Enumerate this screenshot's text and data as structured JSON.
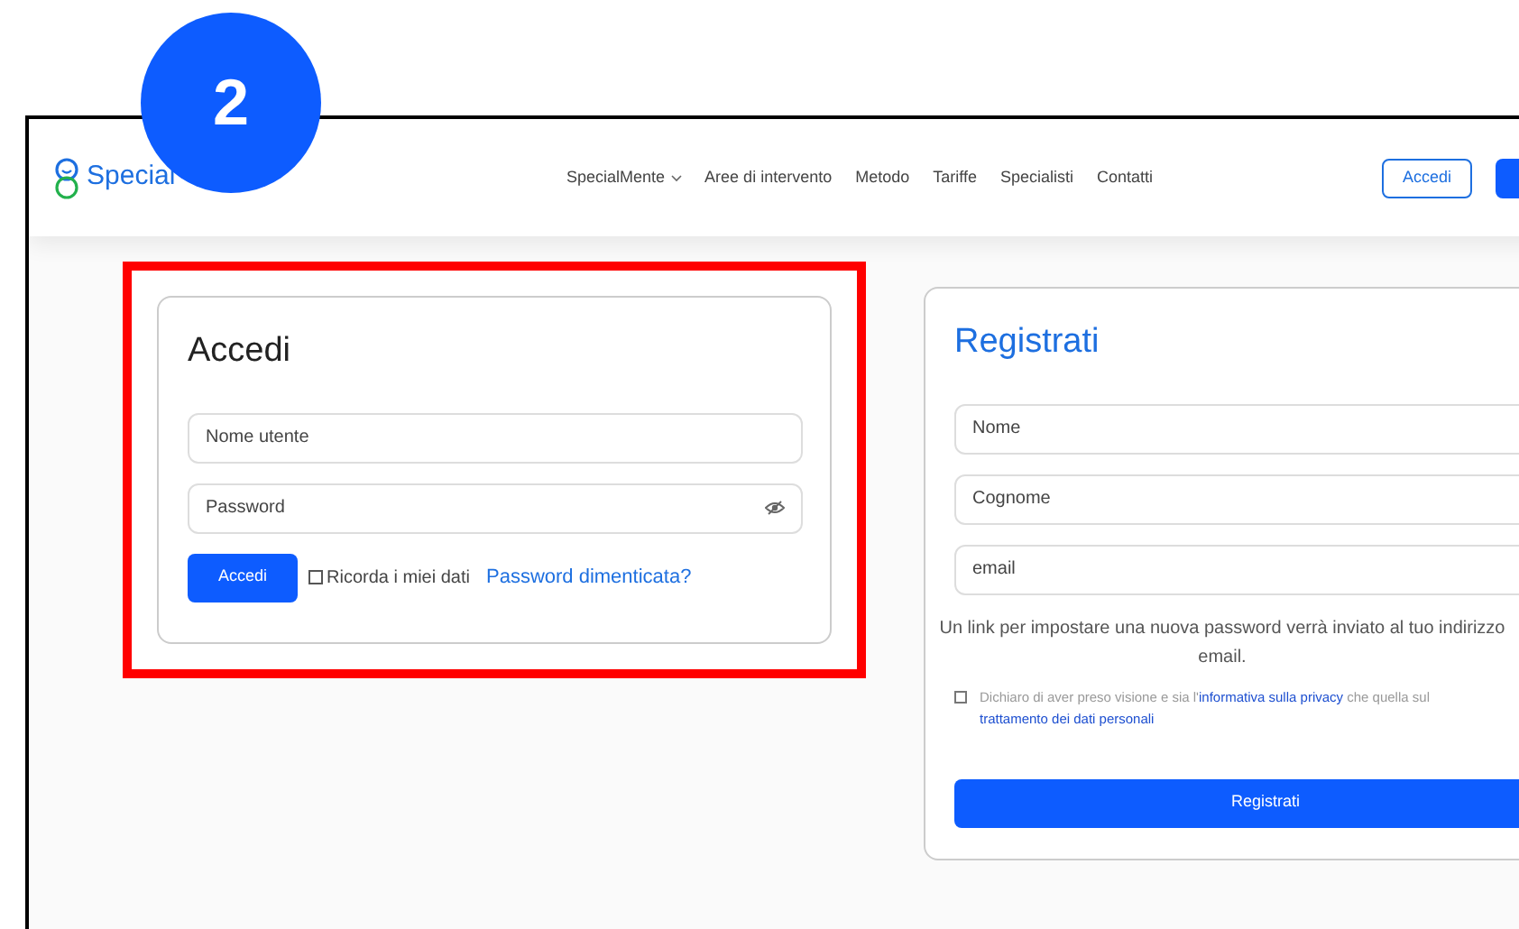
{
  "step_badge": "2",
  "header": {
    "logo": "Special",
    "nav": [
      {
        "label": "SpecialMente",
        "dropdown": true
      },
      {
        "label": "Aree di intervento",
        "dropdown": false
      },
      {
        "label": "Metodo",
        "dropdown": false
      },
      {
        "label": "Tariffe",
        "dropdown": false
      },
      {
        "label": "Specialisti",
        "dropdown": false
      },
      {
        "label": "Contatti",
        "dropdown": false
      }
    ],
    "login_button": "Accedi"
  },
  "login": {
    "title": "Accedi",
    "fields": [
      {
        "placeholder": "Nome utente",
        "kind": "text"
      },
      {
        "placeholder": "Password",
        "kind": "password"
      }
    ],
    "submit": "Accedi",
    "remember": {
      "label": "Ricorda i miei dati",
      "checked": false
    },
    "forgot_link": "Password dimenticata?",
    "highlighted": true
  },
  "register": {
    "title": "Registrati",
    "fields": [
      {
        "placeholder": "Nome"
      },
      {
        "placeholder": "Cognome"
      },
      {
        "placeholder": "email"
      }
    ],
    "note": "Un link per impostare una nuova password verrà inviato al tuo indirizzo email.",
    "privacy": {
      "checked": false,
      "parts": [
        {
          "kind": "text",
          "text": "Dichiaro di aver preso visione e sia l'"
        },
        {
          "kind": "link",
          "text": "informativa sulla privacy"
        },
        {
          "kind": "text",
          "text": " che quella sul "
        },
        {
          "kind": "link",
          "text": "trattamento dei dati personali"
        }
      ]
    },
    "submit": "Registrati"
  }
}
